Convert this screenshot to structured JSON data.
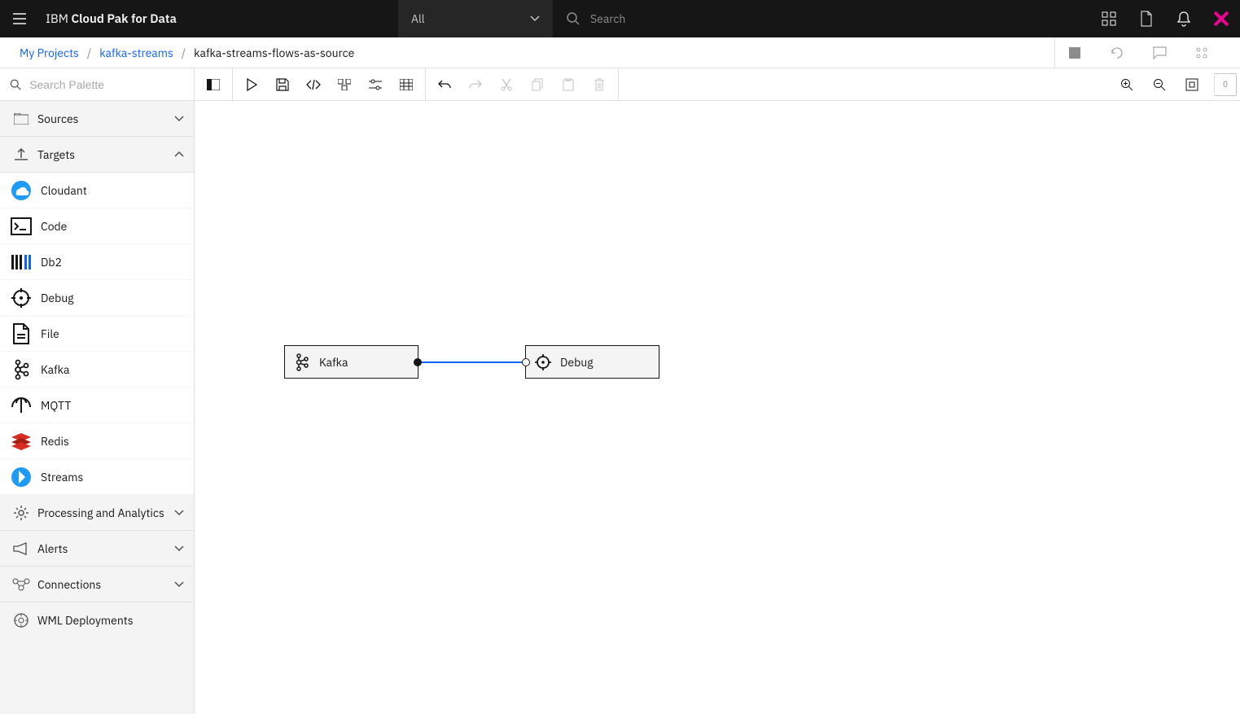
{
  "header": {
    "brand_prefix": "IBM ",
    "brand_main": "Cloud Pak for Data",
    "scope_selected": "All",
    "search_placeholder": "Search"
  },
  "breadcrumb": {
    "root": "My Projects",
    "project": "kafka-streams",
    "current": "kafka-streams-flows-as-source"
  },
  "palette": {
    "search_placeholder": "Search Palette",
    "categories": {
      "sources": "Sources",
      "targets": "Targets",
      "processing": "Processing and Analytics",
      "alerts": "Alerts",
      "connections": "Connections",
      "wml": "WML Deployments"
    },
    "targets_items": {
      "cloudant": "Cloudant",
      "code": "Code",
      "db2": "Db2",
      "debug": "Debug",
      "file": "File",
      "kafka": "Kafka",
      "mqtt": "MQTT",
      "redis": "Redis",
      "streams": "Streams"
    }
  },
  "canvas": {
    "node1": "Kafka",
    "node2": "Debug"
  },
  "panel_badge": "0"
}
